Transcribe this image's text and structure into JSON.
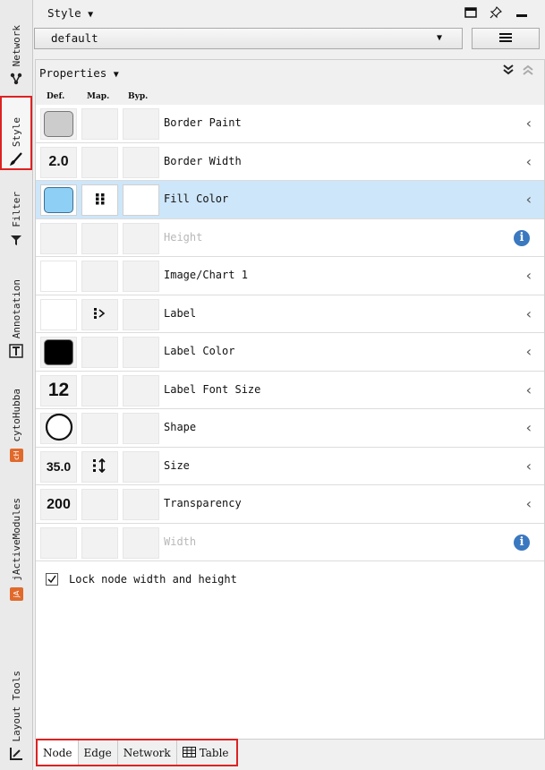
{
  "sidebar": {
    "tabs": [
      {
        "label": "Network",
        "icon": "network-icon"
      },
      {
        "label": "Style",
        "icon": "brush-icon",
        "active": true
      },
      {
        "label": "Filter",
        "icon": "filter-icon"
      },
      {
        "label": "Annotation",
        "icon": "text-annotation-icon"
      },
      {
        "label": "cytoHubba",
        "icon": "cytohubba-icon",
        "badge": "cH"
      },
      {
        "label": "jActiveModules",
        "icon": "jactivemodules-icon",
        "badge": "jA"
      },
      {
        "label": "Layout Tools",
        "icon": "layout-tools-icon"
      }
    ]
  },
  "titlebar": {
    "title": "Style",
    "title_arrow": "▼"
  },
  "style_select": {
    "value": "default",
    "arrow": "▼"
  },
  "properties": {
    "title": "Properties",
    "title_arrow": "▼",
    "columns": {
      "def": "Def.",
      "map": "Map.",
      "byp": "Byp."
    },
    "rows": [
      {
        "label": "Border Paint"
      },
      {
        "label": "Border Width",
        "def": "2.0"
      },
      {
        "label": "Fill Color"
      },
      {
        "label": "Height"
      },
      {
        "label": "Image/Chart 1"
      },
      {
        "label": "Label"
      },
      {
        "label": "Label Color"
      },
      {
        "label": "Label Font Size",
        "def": "12"
      },
      {
        "label": "Shape"
      },
      {
        "label": "Size",
        "def": "35.0"
      },
      {
        "label": "Transparency",
        "def": "200"
      },
      {
        "label": "Width"
      }
    ],
    "lock_label": "Lock node width and height",
    "lock_checked": true
  },
  "colors": {
    "fill_color": "#8ecff5",
    "border_paint": "#cccccc",
    "label_color": "#000000",
    "selected_row": "#cde6f9",
    "highlight": "#dd2222"
  },
  "bottom_tabs": [
    {
      "label": "Node",
      "active": true
    },
    {
      "label": "Edge"
    },
    {
      "label": "Network"
    },
    {
      "label": "Table",
      "icon": "table-icon"
    }
  ]
}
